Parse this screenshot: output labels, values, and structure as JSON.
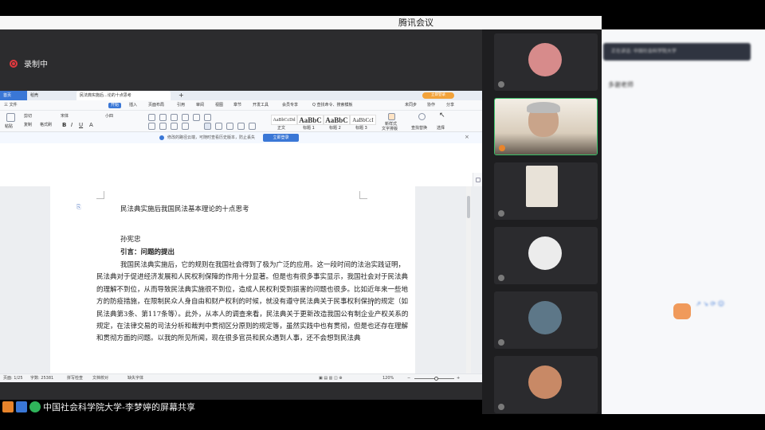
{
  "meeting": {
    "app_title": "腾讯会议",
    "recording_label": "录制中",
    "share_label": "中国社会科学院大学-李梦婷的屏幕共享"
  },
  "wps": {
    "tabs": [
      "首页",
      "稻壳",
      "民法典实施后...论的十点思考"
    ],
    "login_label": "立即登录",
    "menu": [
      "三 文件",
      "开始",
      "插入",
      "页面布局",
      "引用",
      "审阅",
      "视图",
      "章节",
      "开发工具",
      "会员专享",
      "Q 查找命令、搜索模板"
    ],
    "ribbon": {
      "paste": "粘贴",
      "cut": "剪切",
      "copy": "复制",
      "format_painter": "格式刷",
      "font_name": "宋体",
      "font_size": "小四",
      "styles": [
        {
          "sample": "AaBbCcDd",
          "name": "正文"
        },
        {
          "sample": "AaBbC",
          "name": "标题 1"
        },
        {
          "sample": "AaBbC",
          "name": "标题 2"
        },
        {
          "sample": "AaBbCcI",
          "name": "标题 3"
        }
      ],
      "new_style": "新样式",
      "text_tools": "文字排版",
      "find_replace": "查找替换",
      "select": "选择",
      "unsynced": "未同步",
      "collab": "协作",
      "share": "分享"
    },
    "notice": {
      "message": "修改的路径云端，可随时查看历史版本，防止丢失",
      "button": "立即登录"
    },
    "document": {
      "title": "民法典实施后我国民法基本理论的十点思考",
      "author": "孙宪忠",
      "heading": "引言：问题的提出",
      "paragraph_1": "我国民法典实施后，它的规则在我国社会得到了极为广泛的应用。这一段时间的法治实践证明，民法典对于促进经济发展和人民权利保障的作用十分显著。但是也有很多事实显示，我国社会对于民法典的理解不到位，从而导致民法典实施很不到位，造成人民权利受到损害的问题也很多。比如近年来一些地方的防疫措施，在限制民众人身自由和财产权利的时候，就没有遵守民法典关于民事权利保护的规定（如民法典第3条、第117条等）。此外，从本人的调查来看，民法典关于更新改造我国公有制企业产权关系的规定，在法律交易的司法分析和裁判中贯彻区分原则的规定等，虽然实践中也有贯彻，但是也还存在理解和贯彻方面的问题。以我的所见所闻，现在很多官员和民众遇到人事，还不会想到民法典"
    },
    "status": {
      "page": "页面: 1/25",
      "words": "字数: 25381",
      "spell": "拼写检查",
      "proof": "文档校对",
      "font_missing": "缺失字体",
      "zoom": "120%"
    }
  },
  "participants": [
    "",
    "",
    "",
    "",
    "",
    "",
    ""
  ],
  "chat": {
    "banner": "正在讲话: 中国社会科学院大学",
    "messages": [
      {
        "sender": "",
        "text": "多谢老师",
        "time": ""
      },
      {
        "sender": "",
        "text": "",
        "time": ""
      }
    ],
    "input_placeholder": "",
    "colors": {
      "accent": "#3a77d6",
      "bg": "#f7f8fa"
    }
  },
  "colors": {
    "brand": "#3a77d6",
    "record_red": "#e0393e",
    "share_bg": "#2c2c2e",
    "tile_bg": "#2b2b2e"
  }
}
